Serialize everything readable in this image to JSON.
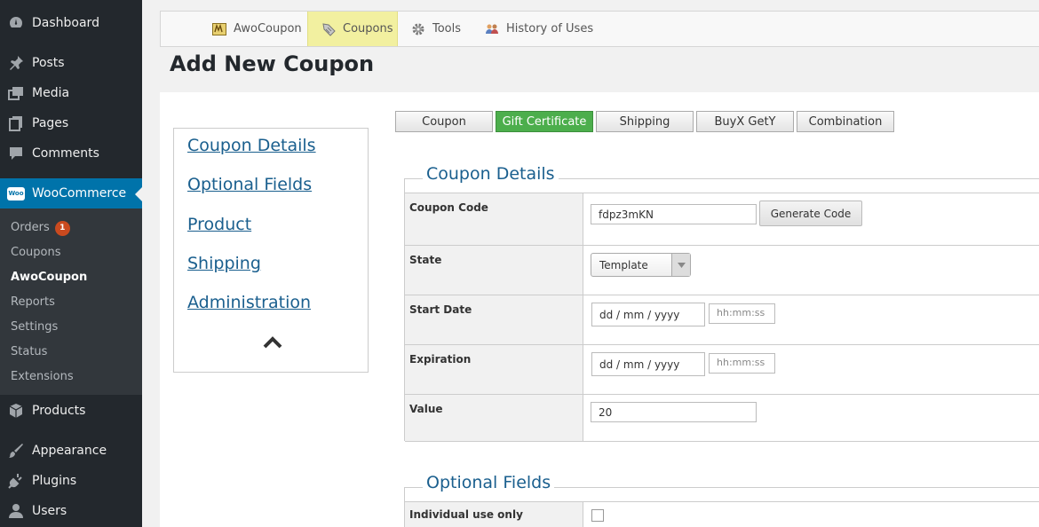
{
  "sidebar": {
    "menu": [
      {
        "label": "Dashboard",
        "icon": "dashboard-icon"
      },
      {
        "label": "Posts",
        "icon": "pin-icon"
      },
      {
        "label": "Media",
        "icon": "media-icon"
      },
      {
        "label": "Pages",
        "icon": "pages-icon"
      },
      {
        "label": "Comments",
        "icon": "comment-icon"
      },
      {
        "label": "WooCommerce",
        "icon": "woo-icon"
      },
      {
        "label": "Products",
        "icon": "box-icon"
      },
      {
        "label": "Appearance",
        "icon": "brush-icon"
      },
      {
        "label": "Plugins",
        "icon": "plug-icon"
      },
      {
        "label": "Users",
        "icon": "user-icon"
      }
    ],
    "submenu": [
      {
        "label": "Orders",
        "badge": "1"
      },
      {
        "label": "Coupons"
      },
      {
        "label": "AwoCoupon"
      },
      {
        "label": "Reports"
      },
      {
        "label": "Settings"
      },
      {
        "label": "Status"
      },
      {
        "label": "Extensions"
      }
    ],
    "woo_logo_text": "Woo"
  },
  "topnav": [
    {
      "label": "AwoCoupon",
      "icon": "awo-logo-icon"
    },
    {
      "label": "Coupons",
      "icon": "coupon-tag-icon"
    },
    {
      "label": "Tools",
      "icon": "gear-icon"
    },
    {
      "label": "History of Uses",
      "icon": "people-icon"
    }
  ],
  "page_title": "Add New Coupon",
  "anchors": [
    "Coupon Details",
    "Optional Fields",
    "Product",
    "Shipping",
    "Administration"
  ],
  "coupon_types": [
    "Coupon",
    "Gift Certificate",
    "Shipping",
    "BuyX GetY",
    "Combination"
  ],
  "active_type": "Gift Certificate",
  "sections": {
    "details": {
      "legend": "Coupon Details",
      "coupon_code": {
        "label": "Coupon Code",
        "value": "fdpz3mKN",
        "button": "Generate Code"
      },
      "state": {
        "label": "State",
        "value": "Template"
      },
      "start_date": {
        "label": "Start Date",
        "date_placeholder": "dd / mm / yyyy",
        "time_placeholder": "hh:mm:ss"
      },
      "expiration": {
        "label": "Expiration",
        "date_placeholder": "dd / mm / yyyy",
        "time_placeholder": "hh:mm:ss"
      },
      "value": {
        "label": "Value",
        "value": "20"
      }
    },
    "optional": {
      "legend": "Optional Fields",
      "individual_use": {
        "label": "Individual use only",
        "checked": false
      }
    }
  },
  "colors": {
    "sidebar_bg": "#23282d",
    "active_menu": "#0073aa",
    "active_type": "#4cae4c",
    "nav_active": "#f2f0a0",
    "link": "#1a5f8e",
    "badge": "#ca4a1f"
  }
}
